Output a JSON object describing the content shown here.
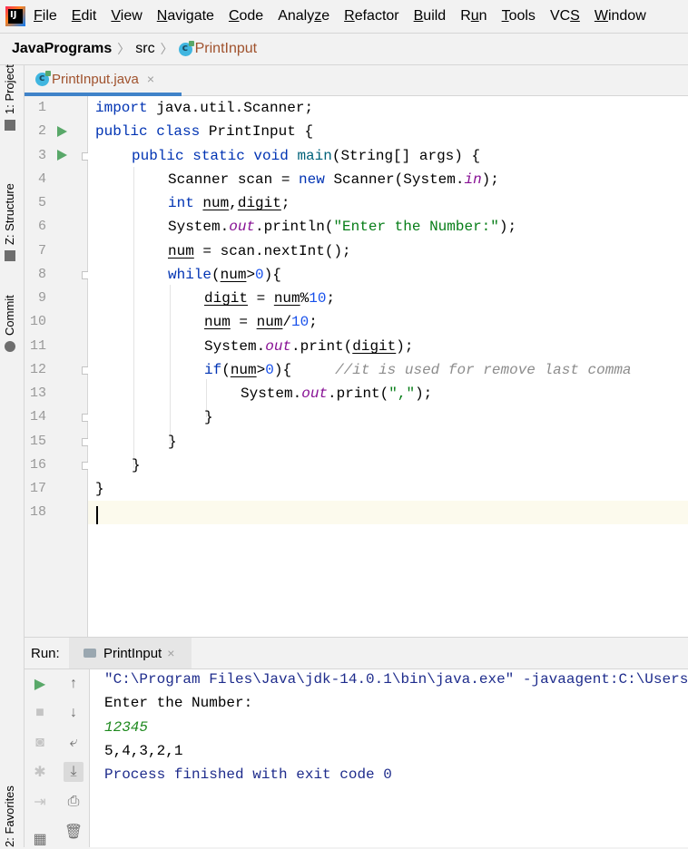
{
  "menubar": {
    "items": [
      {
        "pre": "",
        "u": "F",
        "post": "ile"
      },
      {
        "pre": "",
        "u": "E",
        "post": "dit"
      },
      {
        "pre": "",
        "u": "V",
        "post": "iew"
      },
      {
        "pre": "",
        "u": "N",
        "post": "avigate"
      },
      {
        "pre": "",
        "u": "C",
        "post": "ode"
      },
      {
        "pre": "Analy",
        "u": "z",
        "post": "e"
      },
      {
        "pre": "",
        "u": "R",
        "post": "efactor"
      },
      {
        "pre": "",
        "u": "B",
        "post": "uild"
      },
      {
        "pre": "R",
        "u": "u",
        "post": "n"
      },
      {
        "pre": "",
        "u": "T",
        "post": "ools"
      },
      {
        "pre": "VC",
        "u": "S",
        "post": ""
      },
      {
        "pre": "",
        "u": "W",
        "post": "indow"
      }
    ]
  },
  "breadcrumb": {
    "project": "JavaPrograms",
    "folder": "src",
    "file": "PrintInput"
  },
  "left_strip": {
    "project": "1: Project",
    "structure": "Z: Structure",
    "commit": "Commit",
    "favorites": "2: Favorites"
  },
  "editor_tab": {
    "label": "PrintInput.java",
    "close": "×"
  },
  "gutter": {
    "line_numbers": [
      "1",
      "2",
      "3",
      "4",
      "5",
      "6",
      "7",
      "8",
      "9",
      "10",
      "11",
      "12",
      "13",
      "14",
      "15",
      "16",
      "17",
      "18"
    ]
  },
  "code": {
    "l1a": "import",
    "l1b": " java.util.Scanner;",
    "l2a": "public class",
    "l2b": " PrintInput {",
    "l3a": "public static void",
    "l3b": "main",
    "l3c": "(String[] args) {",
    "l4a": "Scanner scan = ",
    "l4b": "new",
    "l4c": " Scanner(System.",
    "l4d": "in",
    "l4e": ");",
    "l5a": "int",
    "l5b": "num",
    "l5c": ",",
    "l5d": "digit",
    "l5e": ";",
    "l6a": "System.",
    "l6b": "out",
    "l6c": ".println(",
    "l6d": "\"Enter the Number:\"",
    "l6e": ");",
    "l7a": "num",
    "l7b": " = scan.nextInt();",
    "l8a": "while",
    "l8b": "(",
    "l8c": "num",
    "l8d": ">",
    "l8e": "0",
    "l8f": "){",
    "l9a": "digit",
    "l9b": " = ",
    "l9c": "num",
    "l9d": "%",
    "l9e": "10",
    "l9f": ";",
    "l10a": "num",
    "l10b": " = ",
    "l10c": "num",
    "l10d": "/",
    "l10e": "10",
    "l10f": ";",
    "l11a": "System.",
    "l11b": "out",
    "l11c": ".print(",
    "l11d": "digit",
    "l11e": ");",
    "l12a": "if",
    "l12b": "(",
    "l12c": "num",
    "l12d": ">",
    "l12e": "0",
    "l12f": "){",
    "l12g": "//it is used for remove last comma",
    "l13a": "System.",
    "l13b": "out",
    "l13c": ".print(",
    "l13d": "\",\"",
    "l13e": ");",
    "l14": "}",
    "l15": "}",
    "l16": "}",
    "l17": "}"
  },
  "run_panel": {
    "label": "Run:",
    "tab": "PrintInput",
    "close": "×"
  },
  "console": {
    "cmd": "\"C:\\Program Files\\Java\\jdk-14.0.1\\bin\\java.exe\" -javaagent:C:\\Users",
    "prompt": "Enter the Number:",
    "input": "12345",
    "output": "5,4,3,2,1",
    "exit": "Process finished with exit code 0"
  },
  "colors": {
    "keyword": "#0033b3",
    "string": "#067d17",
    "number": "#1750eb",
    "field": "#871094",
    "comment": "#8c8c8c",
    "tab_underline": "#4083c9",
    "run_green": "#59a869"
  },
  "icons": [
    "run-icon",
    "stop-icon",
    "camera-icon",
    "debug-icon",
    "login-icon",
    "layout-icon",
    "arrow-up-icon",
    "arrow-down-icon",
    "soft-wrap-icon",
    "scroll-to-end-icon",
    "print-icon",
    "trash-icon"
  ]
}
